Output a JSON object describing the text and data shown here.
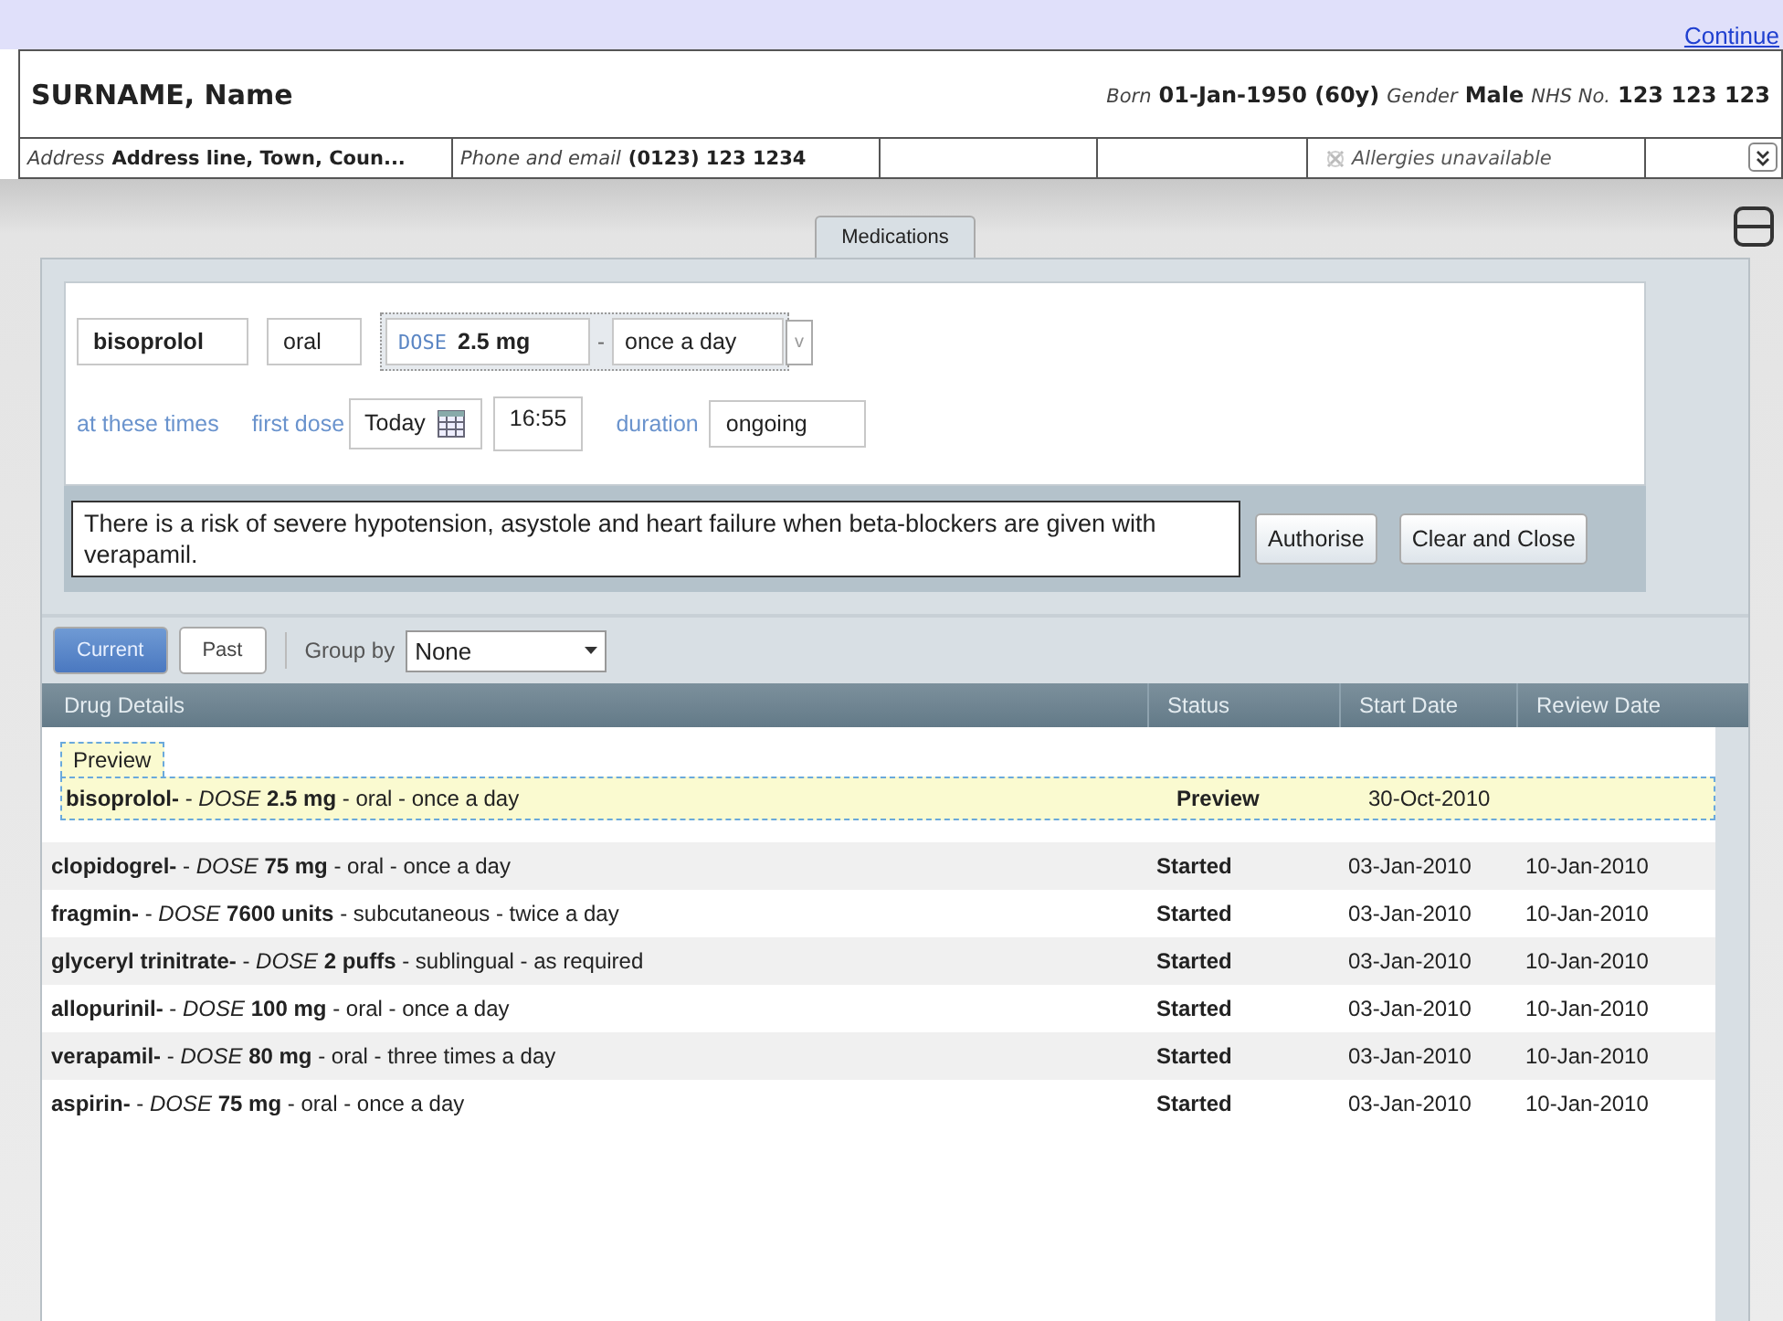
{
  "top_link": "Continue",
  "patient": {
    "name": "SURNAME, Name",
    "born_label": "Born",
    "born": "01-Jan-1950 (60y)",
    "gender_label": "Gender",
    "gender": "Male",
    "nhs_label": "NHS No.",
    "nhs": "123 123 123"
  },
  "details": {
    "address_label": "Address",
    "address": "Address line, Town, Coun...",
    "phone_label": "Phone and email",
    "phone": "(0123) 123 1234",
    "allergies": "Allergies unavailable"
  },
  "tabs": [
    {
      "label": "Medications",
      "selected": true
    }
  ],
  "form": {
    "drug": "bisoprolol",
    "route": "oral",
    "dose_label": "DOSE",
    "dose": "2.5 mg",
    "separator": "-",
    "frequency": "once a day",
    "dropdown": "v",
    "times_link": "at these times",
    "first_dose_label": "first dose",
    "first_dose_day": "Today",
    "first_dose_time": "16:55",
    "duration_label": "duration",
    "duration": "ongoing",
    "warning": "There is a risk of severe hypotension, asystole and heart failure when beta-blockers are given with verapamil.",
    "buttons": [
      "Authorise",
      "Clear and Close"
    ]
  },
  "filters": [
    {
      "label": "Current",
      "selected": true
    },
    {
      "label": "Past",
      "selected": false
    }
  ],
  "group_by": {
    "label": "Group by",
    "value": "None"
  },
  "table": {
    "columns": [
      "Drug Details",
      "Status",
      "Start Date",
      "Review Date"
    ],
    "preview_label": "Preview",
    "rows": [
      {
        "preview": true,
        "details": "**bisoprolol-** - *DOSE* **2.5 mg** - oral - once a day",
        "status": "Preview",
        "start": "30-Oct-2010"
      },
      {
        "preview": false,
        "details": "**clopidogrel-** - *DOSE* **75 mg** - oral - once a day",
        "status": "Started",
        "start": "03-Jan-2010",
        "review": "10-Jan-2010"
      },
      {
        "preview": false,
        "details": "**fragmin-** - *DOSE* **7600 units** - subcutaneous - twice a day",
        "status": "Started",
        "start": "03-Jan-2010",
        "review": "10-Jan-2010"
      },
      {
        "preview": false,
        "details": "**glyceryl trinitrate-** - *DOSE* **2 puffs** - sublingual - as required",
        "status": "Started",
        "start": "03-Jan-2010",
        "review": "10-Jan-2010"
      },
      {
        "preview": false,
        "details": "**allopurinil-** - *DOSE* **100 mg** - oral - once a day",
        "status": "Started",
        "start": "03-Jan-2010",
        "review": "10-Jan-2010"
      },
      {
        "preview": false,
        "details": "**verapamil-** - *DOSE* **80 mg** - oral - three times a day",
        "status": "Started",
        "start": "03-Jan-2010",
        "review": "10-Jan-2010"
      },
      {
        "preview": false,
        "details": "**aspirin-** - *DOSE* **75 mg** - oral - once a day",
        "status": "Started",
        "start": "03-Jan-2010",
        "review": "10-Jan-2010"
      }
    ]
  }
}
